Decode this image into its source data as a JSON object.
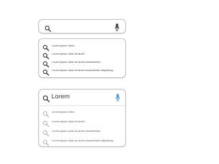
{
  "colors": {
    "border": "#bfbfbf",
    "icon_dark": "#333333",
    "icon_light": "#b8b8b8",
    "mic_accent": "#4a90d9",
    "text": "#3c3c3c"
  },
  "search_bar": {
    "value": "",
    "search_icon": "search-icon",
    "mic_icon": "mic-icon"
  },
  "suggestions_panel": {
    "items": [
      {
        "label": "Lorem ipsum dolor..."
      },
      {
        "label": "Lorem ipsum dolor sit amet..."
      },
      {
        "label": "Lorem ipsum dolor sit amet consectetuer..."
      },
      {
        "label": "Lorem ipsum dolor sit amet consectetuer adipiscing..."
      }
    ]
  },
  "active_search": {
    "query": "Lorem",
    "items": [
      {
        "label": "Lorem ipsum dolor..."
      },
      {
        "label": "Lorem ipsum dolor sit amet..."
      },
      {
        "label": "Lorem ipsum dolor sit amet consectetuer..."
      },
      {
        "label": "Lorem ipsum dolor sit amet consectetuer adipiscing..."
      }
    ]
  }
}
